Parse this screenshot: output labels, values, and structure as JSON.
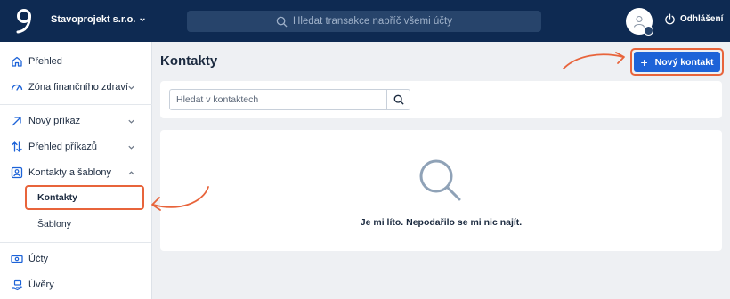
{
  "header": {
    "company": "Stavoprojekt s.r.o.",
    "search_placeholder": "Hledat transakce napříč všemi účty",
    "logout_label": "Odhlášení"
  },
  "sidebar": {
    "items": [
      {
        "label": "Přehled",
        "icon": "home-icon"
      },
      {
        "label": "Zóna finančního zdraví",
        "icon": "gauge-icon"
      },
      {
        "label": "Nový příkaz",
        "icon": "arrow-up-right-icon"
      },
      {
        "label": "Přehled příkazů",
        "icon": "transfer-arrows-icon"
      },
      {
        "label": "Kontakty a šablony",
        "icon": "contact-card-icon"
      },
      {
        "label": "Účty",
        "icon": "banknote-icon"
      },
      {
        "label": "Úvěry",
        "icon": "loan-hand-icon"
      }
    ],
    "subitems": [
      {
        "label": "Kontakty",
        "active": true
      },
      {
        "label": "Šablony",
        "active": false
      }
    ]
  },
  "main": {
    "title": "Kontakty",
    "new_contact_label": "Nový kontakt",
    "contact_search_placeholder": "Hledat v kontaktech",
    "empty_message": "Je mi líto. Nepodařilo se mi nic najít."
  },
  "colors": {
    "header_bg": "#0e2a52",
    "primary": "#1d63d8",
    "highlight": "#e8643b"
  }
}
